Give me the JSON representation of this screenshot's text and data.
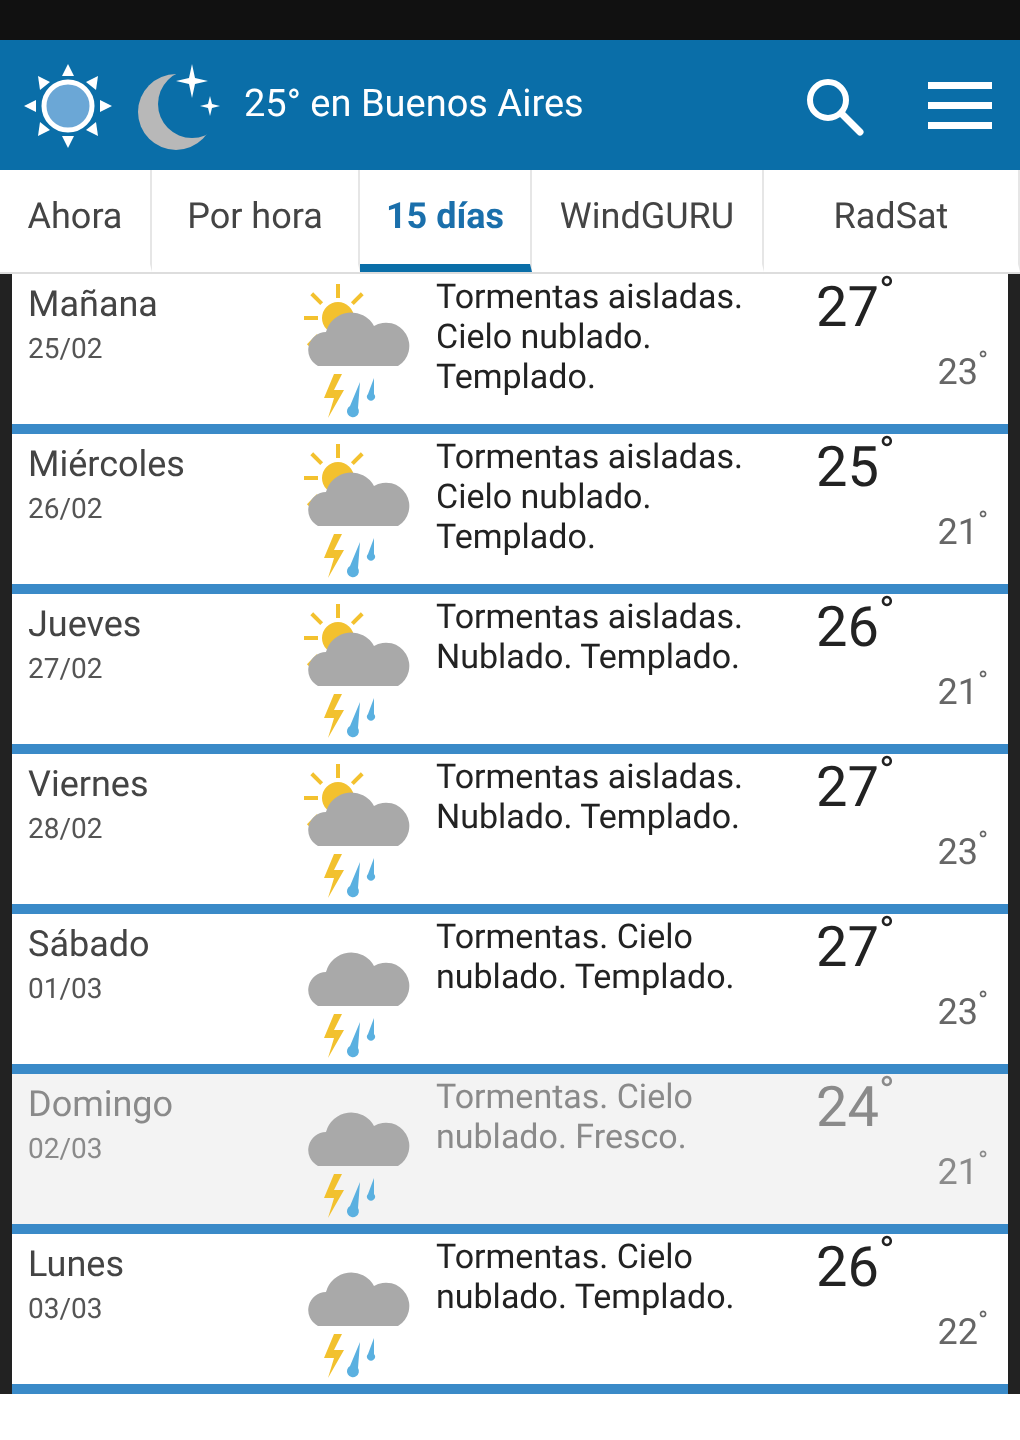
{
  "header": {
    "title": "25° en Buenos Aires"
  },
  "tabs": [
    {
      "label": "Ahora",
      "selected": false
    },
    {
      "label": "Por hora",
      "selected": false
    },
    {
      "label": "15 días",
      "selected": true
    },
    {
      "label": "WindGURU",
      "selected": false
    },
    {
      "label": "RadSat",
      "selected": false
    }
  ],
  "days": [
    {
      "day": "Mañana",
      "date": "25/02",
      "kind": "sun-storm",
      "summary": "Tormentas aisladas. Cielo nublado. Templado.",
      "high": "27$^{°}$",
      "low": "23$^{°}$",
      "dimmed": false
    },
    {
      "day": "Miércoles",
      "date": "26/02",
      "kind": "sun-storm",
      "summary": "Tormentas aisladas. Cielo nublado. Templado.",
      "high": "25$^{°}$",
      "low": "21$^{°}$",
      "dimmed": false
    },
    {
      "day": "Jueves",
      "date": "27/02",
      "kind": "sun-storm",
      "summary": "Tormentas aisladas. Nublado. Templado.",
      "high": "26$^{°}$",
      "low": "21$^{°}$",
      "dimmed": false
    },
    {
      "day": "Viernes",
      "date": "28/02",
      "kind": "sun-storm",
      "summary": "Tormentas aisladas. Nublado. Templado.",
      "high": "27$^{°}$",
      "low": "23$^{°}$",
      "dimmed": false
    },
    {
      "day": "Sábado",
      "date": "01/03",
      "kind": "storm",
      "summary": "Tormentas. Cielo nublado. Templado.",
      "high": "27$^{°}$",
      "low": "23$^{°}$",
      "dimmed": false
    },
    {
      "day": "Domingo",
      "date": "02/03",
      "kind": "storm",
      "summary": "Tormentas. Cielo nublado. Fresco.",
      "high": "24$^{°}$",
      "low": "21$^{°}$",
      "dimmed": true
    },
    {
      "day": "Lunes",
      "date": "03/03",
      "kind": "storm",
      "summary": "Tormentas. Cielo nublado. Templado.",
      "high": "26$^{°}$",
      "low": "22$^{°}$",
      "dimmed": false
    }
  ]
}
